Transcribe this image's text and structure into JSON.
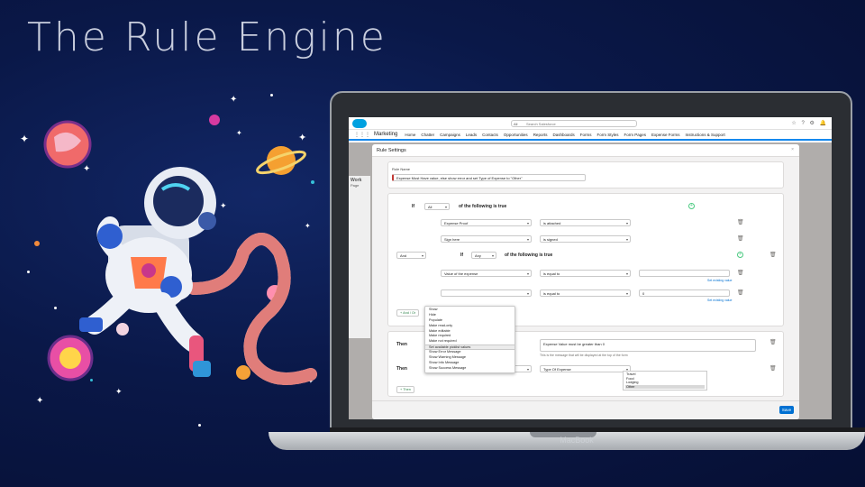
{
  "slide": {
    "title": "The Rule Engine"
  },
  "illustration": {
    "subject": "astronaut-in-space"
  },
  "laptop": {
    "brand": "MacBook"
  },
  "salesforce": {
    "search_scope": "All",
    "search_placeholder": "Search Salesforce",
    "app_name": "Marketing",
    "nav_items": [
      "Home",
      "Chatter",
      "Campaigns",
      "Leads",
      "Contacts",
      "Opportunities",
      "Reports",
      "Dashboards",
      "Forms",
      "Form Styles",
      "Form Pages",
      "Expense Forms",
      "Instructions & Support"
    ],
    "background_card_text": [
      "Work",
      "Page"
    ]
  },
  "modal": {
    "title": "Rule Settings",
    "rule_name_label": "Rule Name",
    "rule_name_value": "Expense Must Have value, else show error and set Type of Expense to \"Other\"",
    "condition": {
      "if_label": "If",
      "match_value": "All",
      "of_following": "of the following is true",
      "rows": [
        {
          "field": "Expense Proof",
          "operator": "is attached"
        },
        {
          "field": "Sign here",
          "operator": "is signed"
        }
      ]
    },
    "group": {
      "connector": "And",
      "if_label": "If",
      "match_value": "Any",
      "of_following": "of the following is true",
      "rows": [
        {
          "field": "Value of the expense",
          "operator": "is equal to",
          "value": "",
          "link": "Set existing value"
        },
        {
          "field": "",
          "operator": "is equal to",
          "value": "0",
          "link": "Set existing value"
        }
      ]
    },
    "add_and_or": "And / Or",
    "actions": {
      "then_label": "Then",
      "dropdown_options": [
        "Show",
        "Hide",
        "Populate",
        "Make read-only",
        "Make editable",
        "Make required",
        "Make not required",
        "Set available picklist values",
        "Show Error Message",
        "Show Warning Message",
        "Show Info Message",
        "Show Success Message"
      ],
      "dropdown_highlighted": "Set available picklist values",
      "error_message": "Expense Value must be greater than 0",
      "error_help": "This is the message that will be displayed at the top of the form",
      "second_action": "Set available picklist values",
      "target_field": "Type Of Expense",
      "picklist_values": [
        "Travel",
        "Food",
        "Lodging",
        "Other"
      ],
      "picklist_selected": "Other",
      "add_then": "Then"
    },
    "save_label": "Save",
    "close_glyph": "×"
  }
}
